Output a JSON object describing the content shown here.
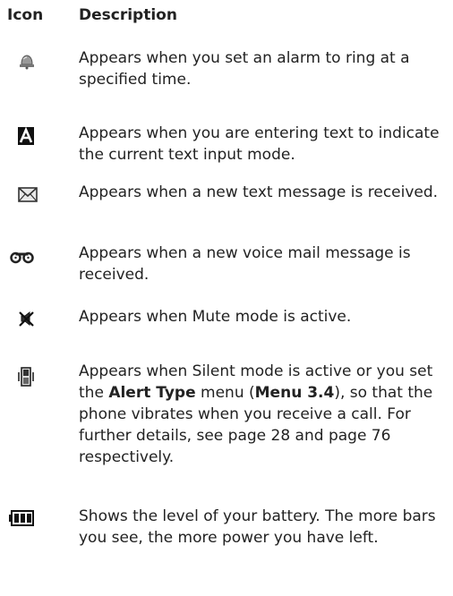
{
  "table": {
    "header": {
      "icon": "Icon",
      "description": "Description"
    },
    "rows": [
      {
        "icon_name": "alarm-icon",
        "text": "Appears when you set an alarm to ring at a specified time."
      },
      {
        "icon_name": "text-input-mode-icon",
        "text": "Appears when you are entering text to indicate the current text input mode."
      },
      {
        "icon_name": "envelope-icon",
        "text": "Appears when a new text message is received."
      },
      {
        "icon_name": "voicemail-icon",
        "text": "Appears when a new voice mail message is received."
      },
      {
        "icon_name": "mute-icon",
        "text": "Appears when Mute mode is active."
      },
      {
        "icon_name": "silent-vibrate-icon",
        "text_parts": {
          "p1": "Appears when Silent mode is active or you set the ",
          "b1": "Alert Type",
          "p2": " menu (",
          "b2": "Menu 3.4",
          "p3": "), so that the phone vibrates when you receive a call. For further details, see page 28 and page 76 respectively."
        }
      },
      {
        "icon_name": "battery-icon",
        "text": "Shows the level of your battery. The more bars you see, the more power you have left."
      }
    ]
  }
}
